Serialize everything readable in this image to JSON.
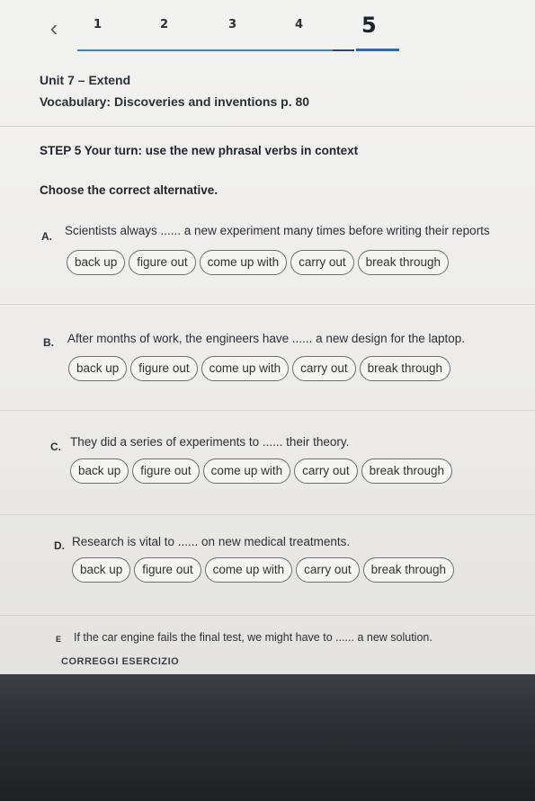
{
  "nav": {
    "back_icon": "chevron-left-icon",
    "steps": [
      "1",
      "2",
      "3",
      "4",
      "5"
    ],
    "active_step": "5",
    "accent": "#3d7fc2"
  },
  "header": {
    "unit": "Unit 7 – Extend",
    "vocabulary": "Vocabulary: Discoveries and inventions p. 80"
  },
  "exercise": {
    "title": "STEP 5 Your turn: use the new phrasal verbs in context",
    "instruction": "Choose the correct alternative.",
    "questions": [
      {
        "letter": "A.",
        "text": "Scientists always ...... a new experiment many times before writing their reports",
        "options": [
          "back up",
          "figure out",
          "come up with",
          "carry out",
          "break through"
        ]
      },
      {
        "letter": "B.",
        "text": "After months of work, the engineers have ...... a new design for the laptop.",
        "options": [
          "back up",
          "figure out",
          "come up with",
          "carry out",
          "break through"
        ]
      },
      {
        "letter": "C.",
        "text": "They did a series of experiments to ...... their theory.",
        "options": [
          "back up",
          "figure out",
          "come up with",
          "carry out",
          "break through"
        ]
      },
      {
        "letter": "D.",
        "text": "Research is vital to ...... on new medical treatments.",
        "options": [
          "back up",
          "figure out",
          "come up with",
          "carry out",
          "break through"
        ]
      },
      {
        "letter": "E",
        "text": "If the car engine fails the final test, we might have to ...... a new solution.",
        "options": []
      }
    ],
    "submit_label": "CORREGGI ESERCIZIO"
  }
}
